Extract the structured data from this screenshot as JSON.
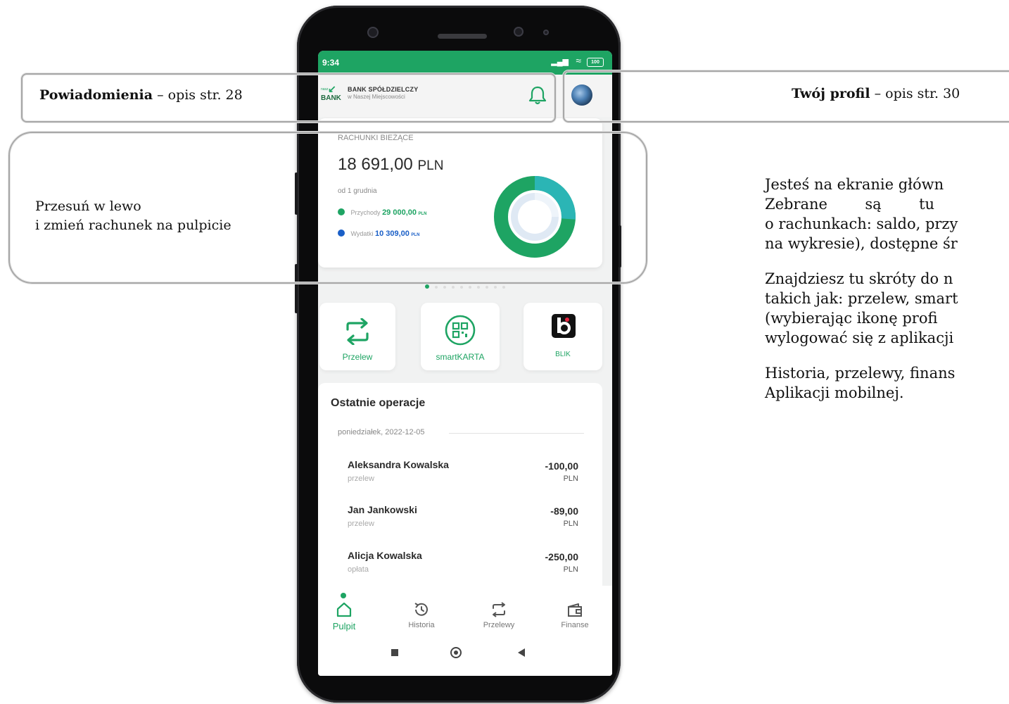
{
  "status_bar": {
    "time": "9:34",
    "signal": "▂▄▆",
    "wifi": "≈",
    "battery": "100"
  },
  "header": {
    "logo_small": "nasz",
    "logo_text": "BANK",
    "bank_name": "BANK SPÓŁDZIELCZY",
    "bank_sub": "w Naszej Miejscowości"
  },
  "account_card": {
    "label": "RACHUNKI BIEŻĄCE",
    "amount": "18 691,00",
    "currency": "PLN",
    "since": "od 1 grudnia",
    "income_label": "Przychody",
    "income_value": "29 000,00",
    "income_currency": "PLN",
    "expense_label": "Wydatki",
    "expense_value": "10 309,00",
    "expense_currency": "PLN",
    "income_share": 0.74,
    "colors": {
      "income": "#1ea463",
      "expense": "#1a5fc7"
    }
  },
  "pager": {
    "total": 10,
    "active": 0
  },
  "shortcuts": [
    {
      "label": "Przelew",
      "icon": "transfer-icon"
    },
    {
      "label": "smartKARTA",
      "icon": "qr-code-icon"
    },
    {
      "label": "BLIK",
      "icon": "blik-logo-icon"
    }
  ],
  "operations": {
    "title": "Ostatnie operacje",
    "date": "poniedziałek, 2022-12-05",
    "items": [
      {
        "name": "Aleksandra Kowalska",
        "type": "przelew",
        "amount": "-100,00",
        "currency": "PLN"
      },
      {
        "name": "Jan Jankowski",
        "type": "przelew",
        "amount": "-89,00",
        "currency": "PLN"
      },
      {
        "name": "Alicja Kowalska",
        "type": "opłata",
        "amount": "-250,00",
        "currency": "PLN"
      }
    ]
  },
  "bottom_nav": [
    {
      "label": "Pulpit",
      "icon": "home-icon",
      "active": true
    },
    {
      "label": "Historia",
      "icon": "history-icon",
      "active": false
    },
    {
      "label": "Przelewy",
      "icon": "transfer-icon",
      "active": false
    },
    {
      "label": "Finanse",
      "icon": "wallet-icon",
      "active": false
    }
  ],
  "callouts": {
    "notifications_bold": "Powiadomienia",
    "notifications_rest": " – opis str. 28",
    "profile_bold": "Twój profil",
    "profile_rest": " – opis str. 30",
    "swipe_line1": "Przesuń w lewo",
    "swipe_line2": "i zmień rachunek na pulpicie"
  },
  "description": [
    "Jesteś na ekranie główn",
    "Zebrane        są        tu",
    "o rachunkach: saldo, przy",
    "na wykresie), dostępne śr",
    "Znajdziesz tu skróty do n",
    "takich jak: przelew, smart",
    "(wybierając ikonę profi",
    "wylogować się z aplikacji",
    "Historia, przelewy, finans",
    "Aplikacji mobilnej."
  ]
}
